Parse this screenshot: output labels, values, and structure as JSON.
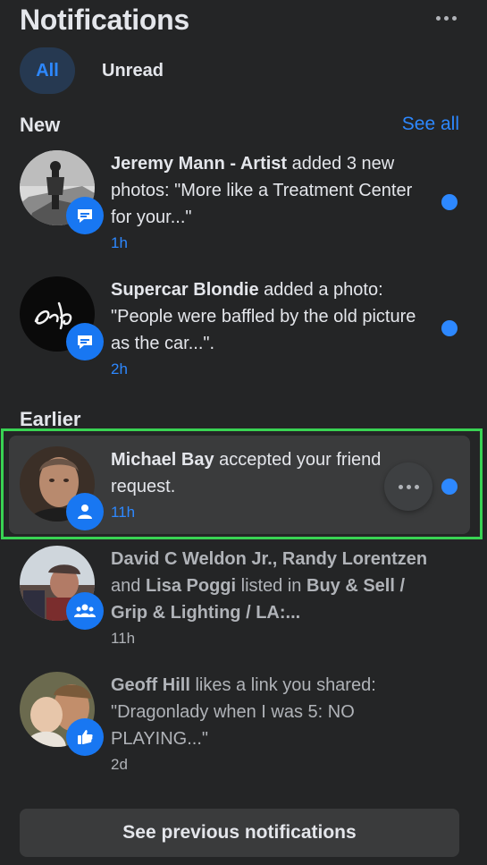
{
  "header": {
    "title": "Notifications",
    "more_icon": "more-horizontal-icon"
  },
  "tabs": [
    {
      "label": "All",
      "active": true
    },
    {
      "label": "Unread",
      "active": false
    }
  ],
  "sections": {
    "new": {
      "label": "New",
      "see_all": "See all"
    },
    "earlier": {
      "label": "Earlier"
    }
  },
  "notifications": [
    {
      "actor": "Jeremy Mann - Artist",
      "text": " added 3 new photos: \"More like a Treatment Center for your...\"",
      "time": "1h",
      "unread": true,
      "badge_icon": "comment-icon"
    },
    {
      "actor": "Supercar Blondie",
      "text": " added a photo: \"People were baffled by the old picture as the car...\".",
      "time": "2h",
      "unread": true,
      "badge_icon": "comment-icon"
    },
    {
      "actor": "Michael Bay",
      "text": " accepted your friend request.",
      "time": "11h",
      "unread": true,
      "badge_icon": "person-icon"
    },
    {
      "actor": "David C Weldon Jr., Randy Lorentzen",
      "mid": " and ",
      "actor2": "Lisa Poggi",
      "text": " listed in ",
      "target": "Buy & Sell / Grip & Lighting / LA:...",
      "time": "11h",
      "unread": false,
      "badge_icon": "group-icon"
    },
    {
      "actor": "Geoff Hill",
      "text": " likes a link you shared: \"Dragonlady when I was 5: NO PLAYING...\"",
      "time": "2d",
      "unread": false,
      "badge_icon": "thumbs-up-icon"
    }
  ],
  "footer": {
    "label": "See previous notifications"
  },
  "colors": {
    "background": "#242526",
    "accent": "#2d88ff",
    "highlight": "#39d353"
  }
}
